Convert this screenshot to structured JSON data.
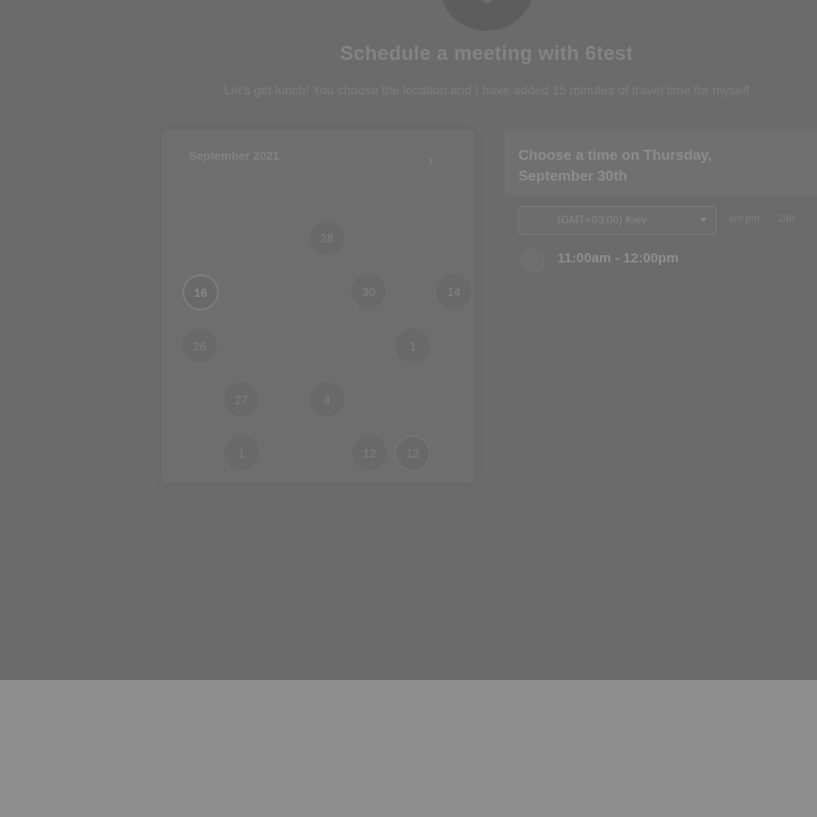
{
  "header": {
    "title": "Schedule a meeting with 6test",
    "subtitle": "Let's get lunch! You choose the location and I have added 15 minutes of travel time for myself"
  },
  "calendar": {
    "month_label": "September 2021",
    "next_icon": "chevron-right-icon",
    "days": [
      {
        "label": "28"
      },
      {
        "label": "16"
      },
      {
        "label": "30"
      },
      {
        "label": "14"
      },
      {
        "label": "26"
      },
      {
        "label": "1"
      },
      {
        "label": "27"
      },
      {
        "label": "4"
      },
      {
        "label": "1"
      },
      {
        "label": "12"
      },
      {
        "label": "13"
      }
    ]
  },
  "time_panel": {
    "heading": "Choose a time on Thursday, September 30th",
    "timezone": "(GMT+03:00) Kiev",
    "format_am_pm": "am pm",
    "format_24h": "24h",
    "slots": [
      {
        "label": "11:00am - 12:00pm"
      }
    ]
  },
  "colors": {
    "overlay": "#6b6b6b",
    "background": "#8e8e8e"
  }
}
